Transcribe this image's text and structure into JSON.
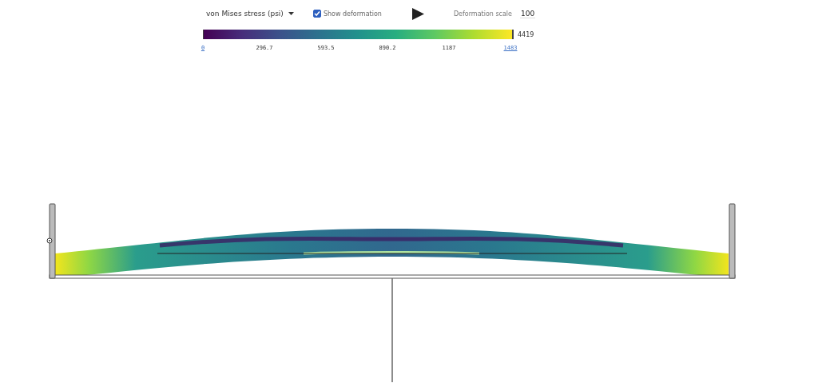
{
  "toolbar": {
    "result_dropdown": {
      "value": "von Mises stress (psi)"
    },
    "show_deformation": {
      "label": "Show deformation",
      "checked": true
    },
    "deformation_scale": {
      "label": "Deformation scale",
      "value": "100"
    }
  },
  "legend": {
    "ticks": [
      {
        "label": "0",
        "kind": "link"
      },
      {
        "label": "296.7",
        "kind": "tick"
      },
      {
        "label": "593.5",
        "kind": "tick"
      },
      {
        "label": "890.2",
        "kind": "tick"
      },
      {
        "label": "1187",
        "kind": "tick"
      },
      {
        "label": "1483",
        "kind": "link"
      }
    ],
    "max_label": "4419"
  }
}
